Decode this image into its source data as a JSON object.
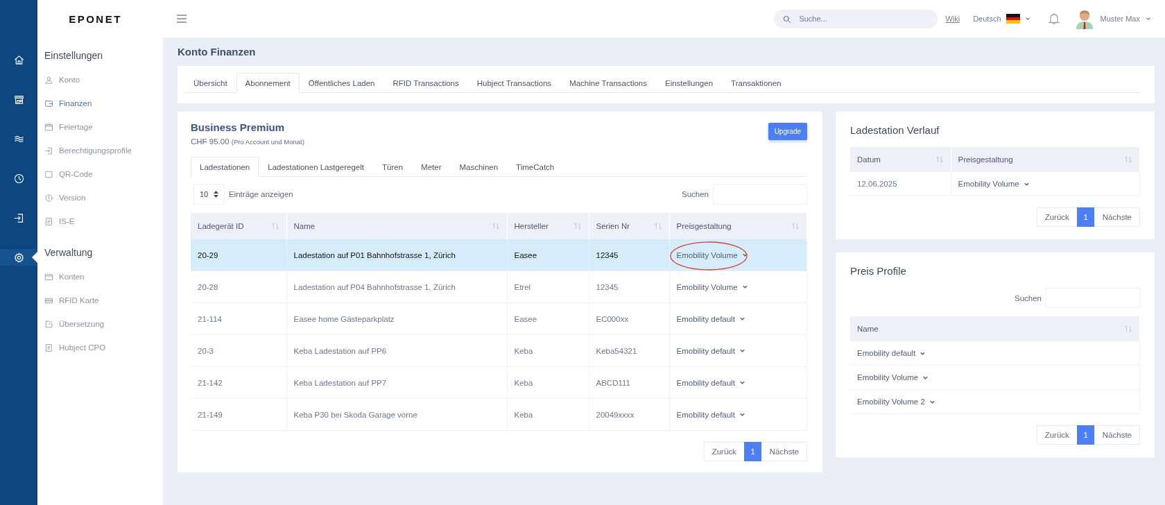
{
  "rail": {
    "items": [
      {
        "kind": "home",
        "selected": false
      },
      {
        "kind": "store",
        "selected": false
      },
      {
        "kind": "waves",
        "selected": false
      },
      {
        "kind": "clock",
        "selected": false
      },
      {
        "kind": "login",
        "selected": false
      },
      {
        "kind": "gear",
        "selected": true
      }
    ]
  },
  "header": {
    "logo": "EPONET",
    "search": {
      "placeholder": "Suche..."
    },
    "wiki": "Wiki",
    "language": "Deutsch",
    "user": "Muster Max"
  },
  "sidebar": {
    "sections": [
      {
        "title": "Einstellungen",
        "items": [
          {
            "label": "Konto",
            "kind": "user",
            "selected": false
          },
          {
            "label": "Finanzen",
            "kind": "wallet",
            "selected": true
          },
          {
            "label": "Feiertage",
            "kind": "calendar",
            "selected": false
          },
          {
            "label": "Berechtigungsprofile",
            "kind": "login",
            "selected": false
          },
          {
            "label": "QR-Code",
            "kind": "square",
            "selected": false
          },
          {
            "label": "Version",
            "kind": "info",
            "selected": false
          },
          {
            "label": "IS-E",
            "kind": "doc",
            "selected": false
          }
        ]
      },
      {
        "title": "Verwaltung",
        "items": [
          {
            "label": "Konten",
            "kind": "window",
            "selected": false
          },
          {
            "label": "RFID Karte",
            "kind": "card",
            "selected": false
          },
          {
            "label": "Übersetzung",
            "kind": "edit",
            "selected": false
          },
          {
            "label": "Hubject CPO",
            "kind": "doc",
            "selected": false
          }
        ]
      }
    ]
  },
  "page_title": "Konto Finanzen",
  "tabs": [
    {
      "label": "Übersicht",
      "selected": false
    },
    {
      "label": "Abonnement",
      "selected": true
    },
    {
      "label": "Öffentliches Laden",
      "selected": false
    },
    {
      "label": "RFID Transactions",
      "selected": false
    },
    {
      "label": "Hubject Transactions",
      "selected": false
    },
    {
      "label": "Machine Transactions",
      "selected": false
    },
    {
      "label": "Einstellungen",
      "selected": false
    },
    {
      "label": "Transaktionen",
      "selected": false
    }
  ],
  "plan": {
    "name": "Business Premium",
    "price": "CHF 95.00",
    "price_note": "(Pro Account und Monat)",
    "upgrade": "Upgrade"
  },
  "subtabs": [
    {
      "label": "Ladestationen",
      "selected": true
    },
    {
      "label": "Ladestationen Lastgeregelt",
      "selected": false
    },
    {
      "label": "Türen",
      "selected": false
    },
    {
      "label": "Meter",
      "selected": false
    },
    {
      "label": "Maschinen",
      "selected": false
    },
    {
      "label": "TimeCatch",
      "selected": false
    }
  ],
  "table": {
    "page_size": "10",
    "page_size_label": "Einträge anzeigen",
    "search_label": "Suchen",
    "columns": [
      "Ladegerät ID",
      "Name",
      "Hersteller",
      "Serien Nr",
      "Preisgestaltung"
    ],
    "rows": [
      {
        "cells": [
          "20-29",
          "Ladestation auf P01 Bahnhofstrasse 1, Zürich",
          "Easee",
          "12345"
        ],
        "pricing": "Emobility Volume",
        "selected": true,
        "circled": true
      },
      {
        "cells": [
          "20-28",
          "Ladestation auf P04 Bahnhofstrasse 1, Zürich",
          "Etrel",
          "12345"
        ],
        "pricing": "Emobility Volume",
        "selected": false,
        "circled": false
      },
      {
        "cells": [
          "21-114",
          "Easee home Gästeparkplatz",
          "Easee",
          "EC000xx"
        ],
        "pricing": "Emobility default",
        "selected": false,
        "circled": false
      },
      {
        "cells": [
          "20-3",
          "Keba Ladestation auf PP6",
          "Keba",
          "Keba54321"
        ],
        "pricing": "Emobility default",
        "selected": false,
        "circled": false
      },
      {
        "cells": [
          "21-142",
          "Keba Ladestation auf PP7",
          "Keba",
          "ABCD111"
        ],
        "pricing": "Emobility default",
        "selected": false,
        "circled": false
      },
      {
        "cells": [
          "21-149",
          "Keba P30 bei Skoda Garage vorne",
          "Keba",
          "20049xxxx"
        ],
        "pricing": "Emobility default",
        "selected": false,
        "circled": false
      }
    ],
    "pagination": {
      "prev": "Zurück",
      "pages": [
        {
          "label": "1",
          "selected": true
        }
      ],
      "next": "Nächste"
    }
  },
  "history": {
    "title": "Ladestation Verlauf",
    "columns": [
      "Datum",
      "Preisgestaltung"
    ],
    "rows": [
      {
        "date": "12.06.2025",
        "pricing": "Emobility Volume"
      }
    ],
    "pagination": {
      "prev": "Zurück",
      "pages": [
        {
          "label": "1",
          "selected": true
        }
      ],
      "next": "Nächste"
    }
  },
  "profiles": {
    "title": "Preis Profile",
    "search_label": "Suchen",
    "columns": [
      "Name"
    ],
    "rows": [
      "Emobility default",
      "Emobility Volume",
      "Emobility Volume 2"
    ],
    "pagination": {
      "prev": "Zurück",
      "pages": [
        {
          "label": "1",
          "selected": true
        }
      ],
      "next": "Nächste"
    }
  }
}
